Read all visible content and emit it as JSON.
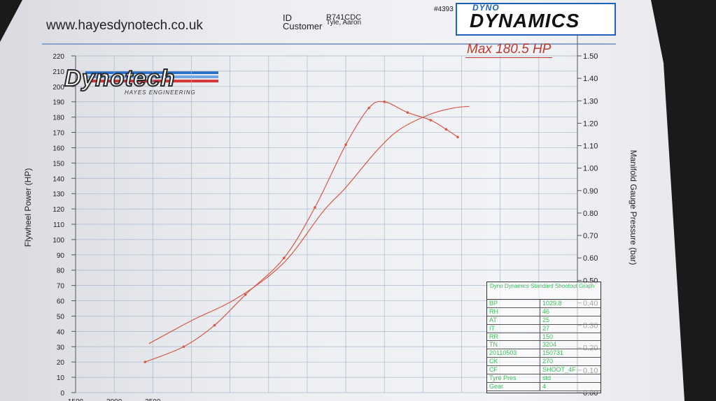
{
  "header": {
    "website": "www.hayesdynotech.co.uk",
    "id_label": "ID",
    "id_value": "R741CDC",
    "customer_label": "Customer",
    "customer_value": "Tyle, Aaron",
    "sheet_number": "#4393",
    "brand_small": "DYNO",
    "brand_big": "DYNAMICS"
  },
  "logo": {
    "text": "Dynotech",
    "subtitle": "HAYES ENGINEERING"
  },
  "annotation": {
    "max_label": "Max 180.5 HP"
  },
  "colors": {
    "curve": "#d65a4a",
    "grid": "#a9b8cc",
    "legend_text": "#3bbf5a",
    "brand_blue": "#1e63b8"
  },
  "legend_box": {
    "title": "Dyno Dynamics Standard Shootout Graph",
    "rows": [
      {
        "key": "BP",
        "value": "1029.8"
      },
      {
        "key": "RH",
        "value": "46"
      },
      {
        "key": "AT",
        "value": "25"
      },
      {
        "key": "IT",
        "value": "27"
      },
      {
        "key": "RR",
        "value": "150"
      },
      {
        "key": "TN",
        "value": "3204"
      },
      {
        "key": "20110503",
        "value": "150731"
      },
      {
        "key": "CK",
        "value": "270"
      },
      {
        "key": "CF",
        "value": "SHOOT_4F"
      },
      {
        "key": "Tyre Pres",
        "value": "std"
      },
      {
        "key": "Gear",
        "value": "4"
      }
    ]
  },
  "chart_data": {
    "type": "line",
    "ylabel": "Flywheel Power (HP)",
    "y2label": "Manifold Gauge Pressure (bar)",
    "xlim": [
      1500,
      8000
    ],
    "ylim": [
      0,
      220
    ],
    "y2lim": [
      0.0,
      1.5
    ],
    "x_ticks": [
      "1500",
      "2000",
      "2500"
    ],
    "y_ticks": [
      0,
      10,
      20,
      30,
      40,
      50,
      60,
      70,
      80,
      90,
      100,
      110,
      120,
      130,
      140,
      150,
      160,
      170,
      180,
      190,
      200,
      210,
      220
    ],
    "y2_ticks": [
      "0.00",
      "0.10",
      "0.20",
      "0.30",
      "0.40",
      "0.50",
      "0.60",
      "0.70",
      "0.80",
      "0.90",
      "1.00",
      "1.10",
      "1.20",
      "1.30",
      "1.40",
      "1.50"
    ],
    "grid": true,
    "series": [
      {
        "axis": "left",
        "marked": true,
        "points": [
          [
            2400,
            20
          ],
          [
            2900,
            30
          ],
          [
            3300,
            44
          ],
          [
            3700,
            64
          ],
          [
            4200,
            88
          ],
          [
            4600,
            121
          ],
          [
            5000,
            162
          ],
          [
            5300,
            186
          ],
          [
            5500,
            190
          ],
          [
            5800,
            183
          ],
          [
            6100,
            178
          ],
          [
            6300,
            172
          ],
          [
            6450,
            167
          ]
        ]
      },
      {
        "axis": "left",
        "marked": false,
        "points": [
          [
            2450,
            32
          ],
          [
            3000,
            47
          ],
          [
            3600,
            62
          ],
          [
            4200,
            85
          ],
          [
            4700,
            118
          ],
          [
            5000,
            134
          ],
          [
            5400,
            158
          ],
          [
            5700,
            172
          ],
          [
            6100,
            182
          ],
          [
            6400,
            186
          ],
          [
            6600,
            187
          ]
        ]
      }
    ]
  }
}
